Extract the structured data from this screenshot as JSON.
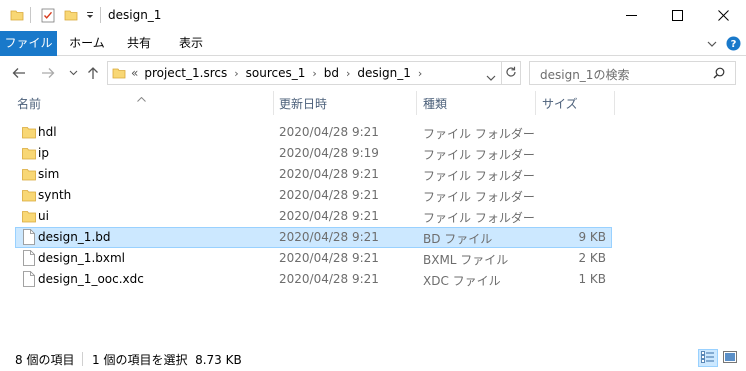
{
  "window": {
    "title": "design_1",
    "minimize_glyph": "—",
    "maximize_glyph": "☐",
    "close_glyph": "✕"
  },
  "ribbon": {
    "tabs": [
      "ファイル",
      "ホーム",
      "共有",
      "表示"
    ],
    "accent": "#1979ca"
  },
  "address": {
    "overflow": "«",
    "crumbs": [
      "project_1.srcs",
      "sources_1",
      "bd",
      "design_1"
    ],
    "search_placeholder": "design_1の検索"
  },
  "columns": {
    "name": "名前",
    "date": "更新日時",
    "type": "種類",
    "size": "サイズ"
  },
  "files": [
    {
      "icon": "folder-icon",
      "name": "hdl",
      "date": "2020/04/28 9:21",
      "type": "ファイル フォルダー",
      "size": ""
    },
    {
      "icon": "folder-icon",
      "name": "ip",
      "date": "2020/04/28 9:19",
      "type": "ファイル フォルダー",
      "size": ""
    },
    {
      "icon": "folder-icon",
      "name": "sim",
      "date": "2020/04/28 9:21",
      "type": "ファイル フォルダー",
      "size": ""
    },
    {
      "icon": "folder-icon",
      "name": "synth",
      "date": "2020/04/28 9:21",
      "type": "ファイル フォルダー",
      "size": ""
    },
    {
      "icon": "folder-icon",
      "name": "ui",
      "date": "2020/04/28 9:21",
      "type": "ファイル フォルダー",
      "size": ""
    },
    {
      "icon": "file-icon",
      "name": "design_1.bd",
      "date": "2020/04/28 9:21",
      "type": "BD ファイル",
      "size": "9 KB",
      "selected": true
    },
    {
      "icon": "file-icon",
      "name": "design_1.bxml",
      "date": "2020/04/28 9:21",
      "type": "BXML ファイル",
      "size": "2 KB"
    },
    {
      "icon": "file-icon",
      "name": "design_1_ooc.xdc",
      "date": "2020/04/28 9:21",
      "type": "XDC ファイル",
      "size": "1 KB"
    }
  ],
  "status": {
    "item_count": "8 個の項目",
    "selection": "1 個の項目を選択  8.73 KB"
  }
}
